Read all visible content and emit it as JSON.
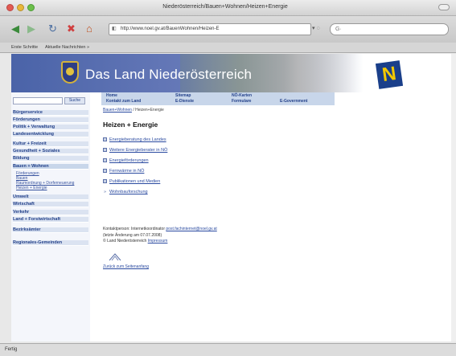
{
  "window": {
    "title": "Niederösterreich/Bauen+Wohnen/Heizen+Energie"
  },
  "toolbar": {
    "url": "http://www.noel.gv.at/BauenWohnen/Heizen-E",
    "url_extra": "▾ ◌",
    "search_placeholder": "G·"
  },
  "bookmarks": {
    "item1": "Erste Schritte",
    "item2": "Aktuelle Nachrichten »"
  },
  "banner": {
    "title": "Das Land Niederösterreich",
    "logo_letter": "N"
  },
  "topnav": {
    "home": "Home",
    "sitemap": "Sitemap",
    "noe_karten": "NÖ-Karten",
    "kontakt": "Kontakt zum Land",
    "edienste": "E-Dienste",
    "formulare": "Formulare",
    "egov": "E-Government"
  },
  "sidebar": {
    "search_button": "Suche",
    "items": [
      "Bürgerservice",
      "Förderungen",
      "Politik + Verwaltung",
      "Landesentwicklung",
      "Kultur + Freizeit",
      "Gesundheit + Soziales",
      "Bildung",
      "Bauen + Wohnen"
    ],
    "subitems": [
      "Förderungen",
      "Bauen",
      "Raumordnung + Dorferneuerung",
      "Heizen + Energie"
    ],
    "items_lower": [
      "Umwelt",
      "Wirtschaft",
      "Verkehr",
      "Land + Forstwirtschaft",
      "Bezirksämter",
      "Regionales-Gemeinden"
    ]
  },
  "main": {
    "breadcrumb_link": "Bauen+Wohnen",
    "breadcrumb_current": "/ Heizen+Energie",
    "title": "Heizen + Energie",
    "links": [
      "Energieberatung des Landes",
      "Weitere Energieberater in NÖ",
      "Energieförderungen",
      "Fernwärme in NÖ",
      "Publikationen und Medien"
    ],
    "last_link": "Wohnbauforschung",
    "contact_label": "Kontaktperson: Internetkoordinator",
    "contact_email": "post.fachinternet@noel.gv.at",
    "updated": "(letzte Änderung am 07.07.2008)",
    "copyright": "© Land Niederösterreich",
    "impressum": "Impressum",
    "back_link": "Zurück zum Seitenanfang"
  },
  "status": {
    "text": "Fertig"
  }
}
